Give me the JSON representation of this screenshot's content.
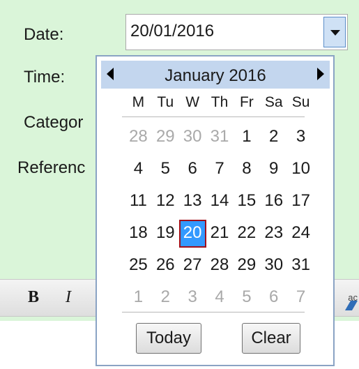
{
  "form": {
    "date_label": "Date:",
    "time_label": "Time:",
    "category_label": "Categor",
    "reference_label": "Referenc",
    "date_value": "20/01/2016"
  },
  "toolbar": {
    "bold_label": "B",
    "italic_label": "I",
    "right_edge_text": "ac"
  },
  "calendar": {
    "month_title": "January 2016",
    "weekdays": [
      "M",
      "Tu",
      "W",
      "Th",
      "Fr",
      "Sa",
      "Su"
    ],
    "weeks": [
      [
        {
          "d": "28",
          "muted": true
        },
        {
          "d": "29",
          "muted": true
        },
        {
          "d": "30",
          "muted": true
        },
        {
          "d": "31",
          "muted": true
        },
        {
          "d": "1"
        },
        {
          "d": "2"
        },
        {
          "d": "3"
        }
      ],
      [
        {
          "d": "4"
        },
        {
          "d": "5"
        },
        {
          "d": "6"
        },
        {
          "d": "7"
        },
        {
          "d": "8"
        },
        {
          "d": "9"
        },
        {
          "d": "10"
        }
      ],
      [
        {
          "d": "11"
        },
        {
          "d": "12"
        },
        {
          "d": "13"
        },
        {
          "d": "14"
        },
        {
          "d": "15"
        },
        {
          "d": "16"
        },
        {
          "d": "17"
        }
      ],
      [
        {
          "d": "18"
        },
        {
          "d": "19"
        },
        {
          "d": "20",
          "selected": true
        },
        {
          "d": "21"
        },
        {
          "d": "22"
        },
        {
          "d": "23"
        },
        {
          "d": "24"
        }
      ],
      [
        {
          "d": "25"
        },
        {
          "d": "26"
        },
        {
          "d": "27"
        },
        {
          "d": "28"
        },
        {
          "d": "29"
        },
        {
          "d": "30"
        },
        {
          "d": "31"
        }
      ],
      [
        {
          "d": "1",
          "muted": true
        },
        {
          "d": "2",
          "muted": true
        },
        {
          "d": "3",
          "muted": true
        },
        {
          "d": "4",
          "muted": true
        },
        {
          "d": "5",
          "muted": true
        },
        {
          "d": "6",
          "muted": true
        },
        {
          "d": "7",
          "muted": true
        }
      ]
    ],
    "today_label": "Today",
    "clear_label": "Clear"
  },
  "colors": {
    "form_background": "#daf5d9",
    "calendar_header": "#c3d6ee",
    "selected_day": "#3399ff",
    "selected_border": "#a10f1a",
    "muted_day": "#a9a9a9"
  }
}
